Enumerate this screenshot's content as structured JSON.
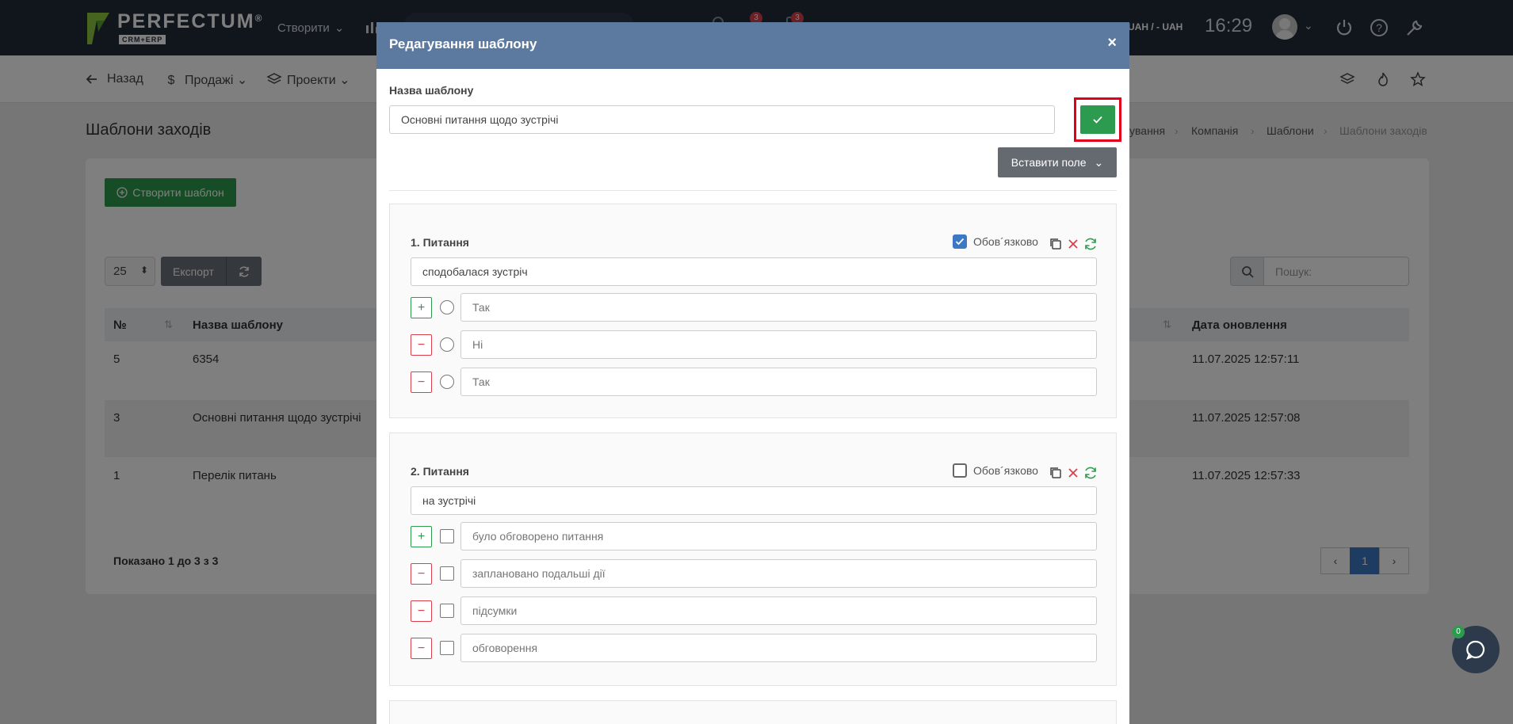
{
  "app": {
    "logo_text": "PERFECTUM",
    "logo_reg": "®",
    "logo_sub": "CRM+ERP",
    "create_label": "Створити",
    "notif_badge_1": "3",
    "notif_badge_2": "3",
    "currency": "UAH / - UAH",
    "clock": "16:29"
  },
  "subnav": {
    "back": "Назад",
    "sales": "Продажі",
    "projects": "Проекти"
  },
  "page": {
    "title": "Шаблони заходів",
    "breadcrumbs": [
      "ування",
      "Компанія",
      "Шаблони",
      "Шаблони заходів"
    ],
    "create_button": "Створити шаблон",
    "page_size": "25",
    "export_button": "Експорт",
    "search_placeholder": "Пошук:",
    "table": {
      "headers": [
        "№",
        "Назва шаблону",
        "Дата оновлення"
      ],
      "rows": [
        {
          "num": "5",
          "name": "6354",
          "updated": "11.07.2025 12:57:11"
        },
        {
          "num": "3",
          "name": "Основні питання щодо зустрічі",
          "updated": "11.07.2025 12:57:08"
        },
        {
          "num": "1",
          "name": "Перелік питань",
          "updated": "11.07.2025 12:57:33"
        }
      ]
    },
    "showing": "Показано 1 до 3 з 3",
    "pagination": {
      "prev": "‹",
      "current": "1",
      "next": "›"
    },
    "chat_badge": "0"
  },
  "modal": {
    "title": "Редагування шаблону",
    "close": "×",
    "name_label": "Назва шаблону",
    "name_value": "Основні питання щодо зустрічі",
    "insert_field_button": "Вставити поле",
    "questions": [
      {
        "title": "1. Питання",
        "required_label": "Обов´язково",
        "required": true,
        "text": "сподобалася зустріч",
        "option_type": "radio",
        "options": [
          "Так",
          "Ні",
          "Так"
        ]
      },
      {
        "title": "2. Питання",
        "required_label": "Обов´язково",
        "required": false,
        "text": "на зустрічі",
        "option_type": "checkbox",
        "options": [
          "було обговорено питання",
          "заплановано подальші дії",
          "підсумки",
          "обговорення"
        ]
      }
    ]
  },
  "colors": {
    "topbar": "#232d3b",
    "modal_header": "#5c7aa0",
    "green": "#2d9b4f",
    "red": "#d9404d",
    "blue": "#3d79c2",
    "highlight_frame": "#e0001a"
  }
}
